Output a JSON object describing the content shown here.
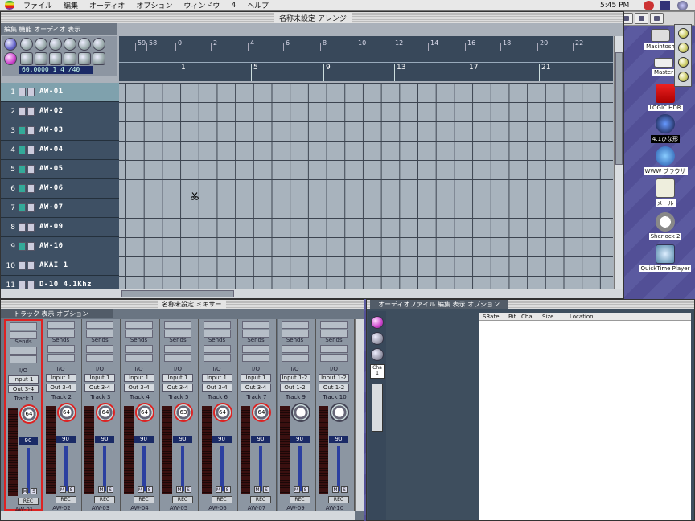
{
  "menubar": {
    "items": [
      "ファイル",
      "編集",
      "オーディオ",
      "オプション",
      "ウィンドウ",
      "4",
      "ヘルプ"
    ],
    "clock": "5:45 PM"
  },
  "arrange": {
    "title": "名称未設定 アレンジ",
    "menu": "編集 機能 オーディオ 表示",
    "position": "60.0000   1   4   /40",
    "ruler_top": [
      "59",
      "58",
      "0",
      "2",
      "4",
      "6",
      "8",
      "10",
      "12",
      "14",
      "16",
      "18",
      "20",
      "22"
    ],
    "ruler_bars": [
      "1",
      "5",
      "9",
      "13",
      "17",
      "21"
    ],
    "tracks": [
      {
        "num": "1",
        "name": "AW-01",
        "selected": true,
        "active": false
      },
      {
        "num": "2",
        "name": "AW-02",
        "selected": false,
        "active": false
      },
      {
        "num": "3",
        "name": "AW-03",
        "selected": false,
        "active": true
      },
      {
        "num": "4",
        "name": "AW-04",
        "selected": false,
        "active": true
      },
      {
        "num": "5",
        "name": "AW-05",
        "selected": false,
        "active": true
      },
      {
        "num": "6",
        "name": "AW-06",
        "selected": false,
        "active": true
      },
      {
        "num": "7",
        "name": "AW-07",
        "selected": false,
        "active": true
      },
      {
        "num": "8",
        "name": "AW-09",
        "selected": false,
        "active": false
      },
      {
        "num": "9",
        "name": "AW-10",
        "selected": false,
        "active": true
      },
      {
        "num": "10",
        "name": "AKAI 1",
        "selected": false,
        "active": false
      },
      {
        "num": "11",
        "name": "D-10 4.1Khz",
        "selected": false,
        "active": false
      }
    ]
  },
  "mixer": {
    "title": "名称未設定 ミキサー",
    "menu": "トラック 表示 オプション",
    "sends_label": "Sends",
    "io_label": "I/O",
    "strips": [
      {
        "input": "Input 1",
        "output": "Out 3-4",
        "track": "Track 1",
        "pan": "64",
        "volume": "90",
        "channel": "AW-01"
      },
      {
        "input": "Input 1",
        "output": "Out 3-4",
        "track": "Track 2",
        "pan": "64",
        "volume": "90",
        "channel": "AW-02"
      },
      {
        "input": "Input 1",
        "output": "Out 3-4",
        "track": "Track 3",
        "pan": "64",
        "volume": "90",
        "channel": "AW-03"
      },
      {
        "input": "Input 1",
        "output": "Out 3-4",
        "track": "Track 4",
        "pan": "64",
        "volume": "90",
        "channel": "AW-04"
      },
      {
        "input": "Input 1",
        "output": "Out 3-4",
        "track": "Track 5",
        "pan": "63",
        "volume": "90",
        "channel": "AW-05"
      },
      {
        "input": "Input 1",
        "output": "Out 3-4",
        "track": "Track 6",
        "pan": "64",
        "volume": "90",
        "channel": "AW-06"
      },
      {
        "input": "Input 1",
        "output": "Out 3-4",
        "track": "Track 7",
        "pan": "64",
        "volume": "90",
        "channel": "AW-07"
      },
      {
        "input": "Input 1-2",
        "output": "Out 1-2",
        "track": "Track 9",
        "pan": "",
        "volume": "90",
        "channel": "AW-09"
      },
      {
        "input": "Input 1-2",
        "output": "Out 1-2",
        "track": "Track 10",
        "pan": "",
        "volume": "90",
        "channel": "AW-10"
      }
    ],
    "m_label": "M",
    "s_label": "S",
    "rec_label": "REC"
  },
  "audio": {
    "title": "オーディオファイル 編集 表示 オプション",
    "columns": [
      "SRate",
      "Bit",
      "Cha",
      "Size",
      "Location"
    ],
    "cha_value": "Cha 1"
  },
  "desktop": {
    "icons": [
      "Macintosh",
      "Master",
      "LOGIC HDR",
      "4.1ひな形",
      "WWW ブラウザ",
      "メール",
      "Sherlock 2",
      "QuickTime Player"
    ]
  },
  "colors": {
    "track_selected": "#7fa1ad",
    "track_bg": "#3e5064",
    "grid_bg": "#a8b3bd",
    "knob_ring": "#dd2222",
    "position_bg": "#1a2a66"
  }
}
